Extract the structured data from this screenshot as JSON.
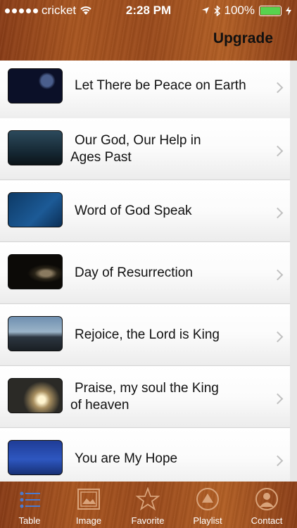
{
  "status": {
    "carrier": "cricket",
    "time": "2:28 PM",
    "battery": "100%"
  },
  "header": {
    "upgrade_label": "Upgrade"
  },
  "songs": [
    {
      "title": "Let There be Peace on Earth"
    },
    {
      "title": "Our God, Our Help in",
      "title_line2": "Ages Past"
    },
    {
      "title": "Word of God Speak"
    },
    {
      "title": "Day of Resurrection"
    },
    {
      "title": "Rejoice, the Lord is King"
    },
    {
      "title": "Praise, my soul the King",
      "title_line2": "of heaven"
    },
    {
      "title": "You are My Hope"
    }
  ],
  "tabs": [
    {
      "label": "Table",
      "icon": "list-icon"
    },
    {
      "label": "Image",
      "icon": "image-icon"
    },
    {
      "label": "Favorite",
      "icon": "star-icon"
    },
    {
      "label": "Playlist",
      "icon": "playlist-icon"
    },
    {
      "label": "Contact",
      "icon": "contact-icon"
    }
  ],
  "colors": {
    "wood": "#9b4a1b",
    "battery": "#57d24d",
    "text": "#111111"
  }
}
